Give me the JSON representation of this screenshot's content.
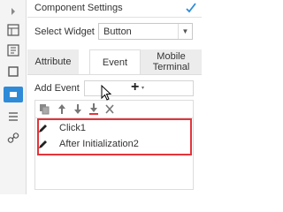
{
  "panel": {
    "title": "Component Settings"
  },
  "widget_select": {
    "label": "Select Widget",
    "value": "Button"
  },
  "tabs": [
    {
      "label": "Attribute",
      "active": false
    },
    {
      "label": "Event",
      "active": true
    },
    {
      "label": "Mobile Terminal",
      "active": false
    }
  ],
  "add_event": {
    "label": "Add Event",
    "plus": "+",
    "caret": "▾"
  },
  "events": [
    {
      "label": "Click1"
    },
    {
      "label": "After Initialization2"
    }
  ],
  "colors": {
    "accent": "#2f8bd8",
    "highlight_border": "#e3343a"
  },
  "sidebar_icons": [
    "collapse-arrow-icon",
    "form-layout-icon",
    "template-icon",
    "frame-icon",
    "widget-settings-icon",
    "list-settings-icon",
    "link-icon"
  ],
  "toolbar_icons": [
    "copy-icon",
    "move-up-icon",
    "move-down-icon",
    "move-to-bottom-icon",
    "delete-icon"
  ]
}
